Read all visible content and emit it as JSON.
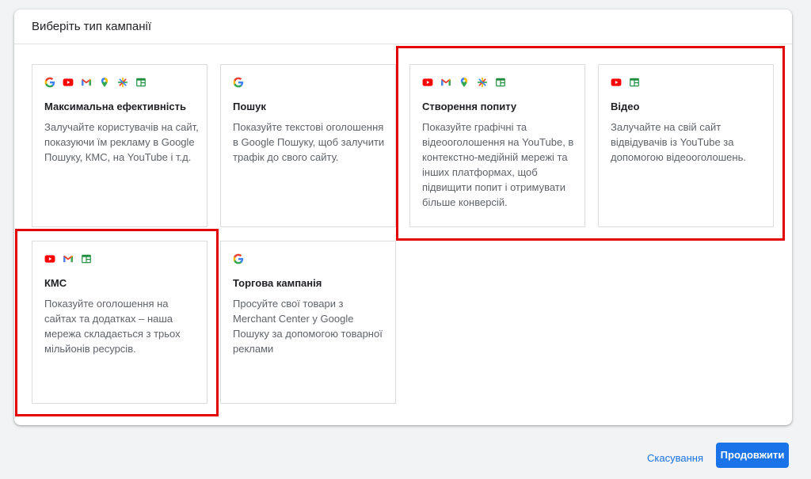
{
  "dialog": {
    "title": "Виберіть тип кампанії"
  },
  "cards": [
    {
      "title": "Максимальна ефективність",
      "description": "Залучайте користувачів на сайт, показуючи їм рекламу в Google Пошуку, КМС, на YouTube і т.д.",
      "icons": [
        "google-icon",
        "youtube-icon",
        "gmail-icon",
        "maps-icon",
        "discover-icon",
        "display-icon"
      ]
    },
    {
      "title": "Пошук",
      "description": "Показуйте текстові оголошення в Google Пошуку, щоб залучити трафік до свого сайту.",
      "icons": [
        "google-icon"
      ]
    },
    {
      "title": "Створення попиту",
      "description": "Показуйте графічні та відеооголошення на YouTube, в контекстно-медійній мережі та інших платформах, щоб підвищити попит і отримувати більше конверсій.",
      "icons": [
        "youtube-icon",
        "gmail-icon",
        "maps-icon",
        "discover-icon",
        "display-icon"
      ]
    },
    {
      "title": "Відео",
      "description": "Залучайте на свій сайт відвідувачів із YouTube за допомогою відеооголошень.",
      "icons": [
        "youtube-icon",
        "display-icon"
      ]
    },
    {
      "title": "КМС",
      "description": "Показуйте оголошення на сайтах та додатках – наша мережа складається з трьох мільйонів ресурсів.",
      "icons": [
        "youtube-icon",
        "gmail-icon",
        "display-icon"
      ]
    },
    {
      "title": "Торгова кампанія",
      "description": "Просуйте свої товари з Merchant Center у Google Пошуку за допомогою товарної реклами",
      "icons": [
        "google-icon"
      ]
    }
  ],
  "footer": {
    "cancel_label": "Скасування",
    "continue_label": "Продовжити"
  },
  "colors": {
    "accent": "#1a73e8",
    "highlight": "#e50000",
    "youtube": "#ff0000",
    "google_blue": "#4285f4",
    "google_red": "#ea4335",
    "google_yellow": "#fbbc04",
    "google_green": "#34a853"
  }
}
